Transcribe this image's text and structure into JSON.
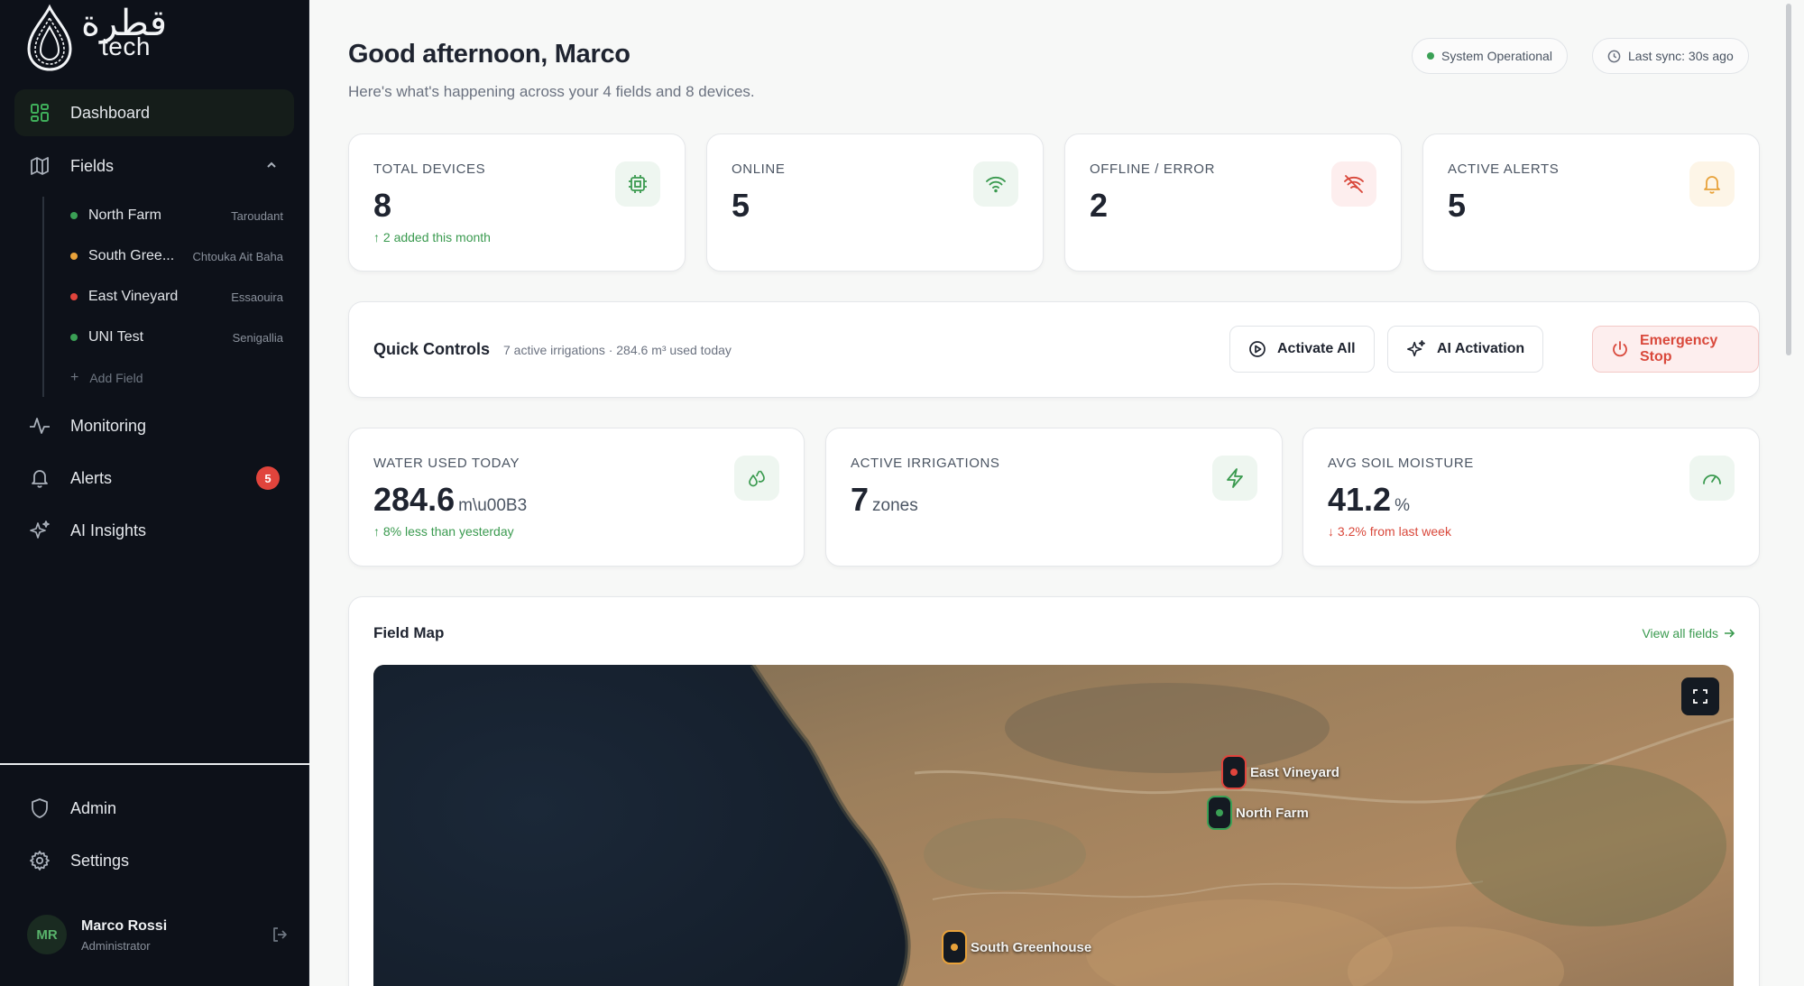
{
  "brand": {
    "arabic": "قطرة",
    "latin": "tech"
  },
  "sidebar": {
    "nav": [
      {
        "label": "Dashboard",
        "icon": "dashboard-grid-icon",
        "active": true
      },
      {
        "label": "Fields",
        "icon": "map-icon"
      },
      {
        "label": "Monitoring",
        "icon": "activity-icon"
      },
      {
        "label": "Alerts",
        "icon": "bell-icon",
        "badge": "5"
      },
      {
        "label": "AI Insights",
        "icon": "sparkles-icon"
      },
      {
        "label": "Admin",
        "icon": "shield-icon"
      },
      {
        "label": "Settings",
        "icon": "gear-icon"
      }
    ],
    "fields": [
      {
        "name": "North Farm",
        "location": "Taroudant",
        "status_color": "#3aa055"
      },
      {
        "name": "South Gree...",
        "location": "Chtouka Ait Baha",
        "status_color": "#e8a23a"
      },
      {
        "name": "East Vineyard",
        "location": "Essaouira",
        "status_color": "#e0443c"
      },
      {
        "name": "UNI Test",
        "location": "Senigallia",
        "status_color": "#3aa055"
      }
    ],
    "add_field_label": "Add Field",
    "user": {
      "initials": "MR",
      "name": "Marco Rossi",
      "role": "Administrator"
    }
  },
  "header": {
    "greeting": "Good afternoon, Marco",
    "subtitle": "Here's what's happening across your 4 fields and 8 devices.",
    "status_pill": "System Operational",
    "sync_pill": "Last sync: 30s ago"
  },
  "stats_top": [
    {
      "label": "TOTAL DEVICES",
      "value": "8",
      "note": "↑ 2 added this month",
      "icon": "chip-icon",
      "icon_bg": "#eef6f0",
      "icon_color": "#3a9a4f"
    },
    {
      "label": "ONLINE",
      "value": "5",
      "note": "",
      "icon": "wifi-icon",
      "icon_bg": "#eef6f0",
      "icon_color": "#3a9a4f"
    },
    {
      "label": "OFFLINE / ERROR",
      "value": "2",
      "note": "",
      "icon": "wifi-off-icon",
      "icon_bg": "#fdeeee",
      "icon_color": "#d9483b"
    },
    {
      "label": "ACTIVE ALERTS",
      "value": "5",
      "note": "",
      "icon": "bell-icon",
      "icon_bg": "#fdf5e7",
      "icon_color": "#e8a23a"
    }
  ],
  "quick_controls": {
    "title": "Quick Controls",
    "subtitle": "7 active irrigations · 284.6 m³ used today",
    "activate_all": "Activate All",
    "ai_activation": "AI Activation",
    "emergency_stop": "Emergency Stop"
  },
  "stats_bottom": [
    {
      "label": "WATER USED TODAY",
      "value": "284.6",
      "unit": "m\\u00B3",
      "note": "↑ 8% less than yesterday",
      "note_color": "green",
      "icon": "droplets-icon"
    },
    {
      "label": "ACTIVE IRRIGATIONS",
      "value": "7",
      "unit": "zones",
      "note": "",
      "note_color": "green",
      "icon": "zap-icon"
    },
    {
      "label": "AVG SOIL MOISTURE",
      "value": "41.2",
      "unit": "%",
      "note": "↓ 3.2% from last week",
      "note_color": "red",
      "icon": "gauge-icon"
    }
  ],
  "field_map": {
    "title": "Field Map",
    "view_all": "View all fields",
    "markers": [
      {
        "name": "East Vineyard",
        "color": "#e0443c"
      },
      {
        "name": "North Farm",
        "color": "#3aa055"
      },
      {
        "name": "South Greenhouse",
        "color": "#e8a23a"
      }
    ]
  },
  "colors": {
    "accent": "#3a9a4f",
    "danger": "#d9483b",
    "warning": "#e8a23a",
    "sidebar_bg": "#0d1119"
  }
}
